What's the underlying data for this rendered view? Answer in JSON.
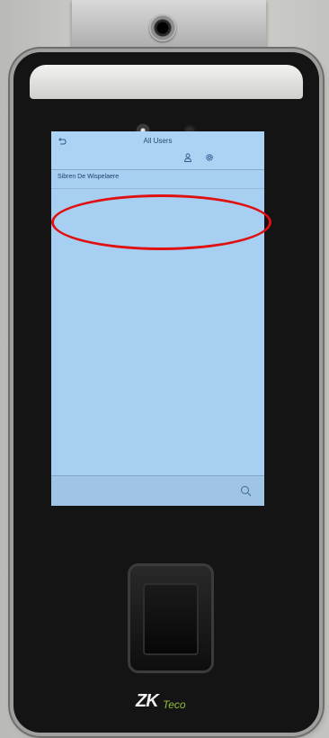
{
  "screen": {
    "title": "All Users",
    "users": [
      {
        "name": "Sibren De Wispelaere"
      }
    ],
    "icons": {
      "back": "back-arrow-icon",
      "user": "user-icon",
      "settings": "gear-icon",
      "search": "search-icon"
    },
    "colors": {
      "screen_bg": "#a7cff2",
      "title_text": "#254a73",
      "highlight": "#e01010"
    }
  },
  "device": {
    "logo_prefix": "ZK",
    "logo_suffix": "Teco"
  }
}
